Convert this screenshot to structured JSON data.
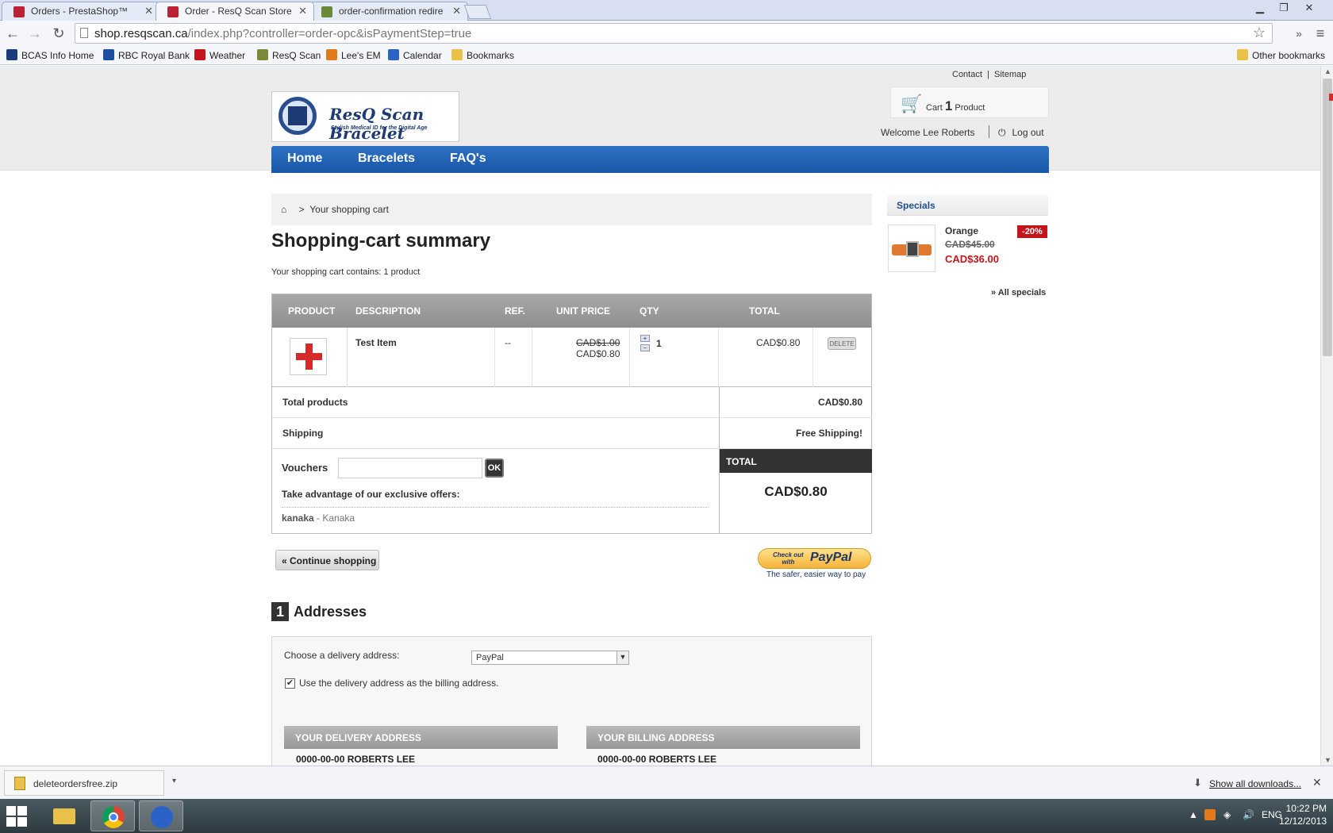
{
  "browser": {
    "tabs": [
      {
        "title": "Orders - PrestaShop™"
      },
      {
        "title": "Order - ResQ Scan Store"
      },
      {
        "title": "order-confirmation redire"
      }
    ],
    "url_host": "shop.resqscan.ca",
    "url_path": "/index.php?controller=order-opc&isPaymentStep=true",
    "bookmarks": [
      {
        "label": "BCAS Info Home",
        "icon": "star-of-life-icon",
        "color": "#1c3b7a"
      },
      {
        "label": "RBC Royal Bank",
        "icon": "rbc-icon",
        "color": "#1c4fa0"
      },
      {
        "label": "Weather",
        "icon": "maple-leaf-icon",
        "color": "#c4151c"
      },
      {
        "label": "ResQ Scan",
        "icon": "resq-icon",
        "color": "#7a8a3a"
      },
      {
        "label": "Lee's EM",
        "icon": "cp-icon",
        "color": "#e07a1a"
      },
      {
        "label": "Calendar",
        "icon": "calendar-icon",
        "color": "#2a62c8"
      },
      {
        "label": "Bookmarks",
        "icon": "folder-icon",
        "color": "#e8c04a"
      }
    ],
    "other_bookmarks": "Other bookmarks"
  },
  "site": {
    "top_links": {
      "contact": "Contact",
      "divider": "|",
      "sitemap": "Sitemap"
    },
    "logo": {
      "title": "ResQ Scan Bracelet",
      "tagline": "Stylish Medical ID for the Digital Age"
    },
    "cart": {
      "label": "Cart",
      "count": "1",
      "unit": "Product"
    },
    "welcome": "Welcome Lee Roberts",
    "logout": "Log out",
    "nav": [
      "Home",
      "Bracelets",
      "FAQ's"
    ]
  },
  "breadcrumb": {
    "separator": ">",
    "current": "Your shopping cart"
  },
  "page_title": "Shopping-cart summary",
  "cart_contains": "Your shopping cart contains: 1 product",
  "cart_table": {
    "headers": [
      "PRODUCT",
      "DESCRIPTION",
      "REF.",
      "UNIT PRICE",
      "QTY",
      "TOTAL"
    ],
    "rows": [
      {
        "name": "Test Item",
        "ref": "--",
        "old_price": "CAD$1.00",
        "price": "CAD$0.80",
        "qty": "1",
        "total": "CAD$0.80",
        "delete": "DELETE"
      }
    ],
    "total_products_label": "Total products",
    "total_products_value": "CAD$0.80",
    "shipping_label": "Shipping",
    "shipping_value": "Free Shipping!",
    "vouchers_label": "Vouchers",
    "ok_label": "OK",
    "offers_heading": "Take advantage of our exclusive offers:",
    "offer_code": "kanaka",
    "offer_name": " - Kanaka",
    "total_label": "TOTAL",
    "total_value": "CAD$0.80"
  },
  "continue_shopping": "« Continue shopping",
  "paypal": {
    "line1": "Check out",
    "line2": "with",
    "brand": "PayPal",
    "tagline": "The safer, easier way to pay"
  },
  "addresses": {
    "step_number": "1",
    "heading": "Addresses",
    "choose_label": "Choose a delivery address:",
    "selected": "PayPal",
    "same_billing_label": "Use the delivery address as the billing address.",
    "same_billing_checked": true,
    "delivery_heading": "YOUR DELIVERY ADDRESS",
    "billing_heading": "YOUR BILLING ADDRESS",
    "delivery_name": "0000-00-00 ROBERTS LEE",
    "billing_name": "0000-00-00 ROBERTS LEE"
  },
  "specials": {
    "heading": "Specials",
    "product": "Orange",
    "badge": "-20%",
    "old_price": "CAD$45.00",
    "new_price": "CAD$36.00",
    "all_link": "» All specials"
  },
  "downloads": {
    "file": "deleteordersfree.zip",
    "show_all": "Show all downloads..."
  },
  "taskbar": {
    "language": "ENG",
    "time": "10:22 PM",
    "date": "12/12/2013"
  }
}
